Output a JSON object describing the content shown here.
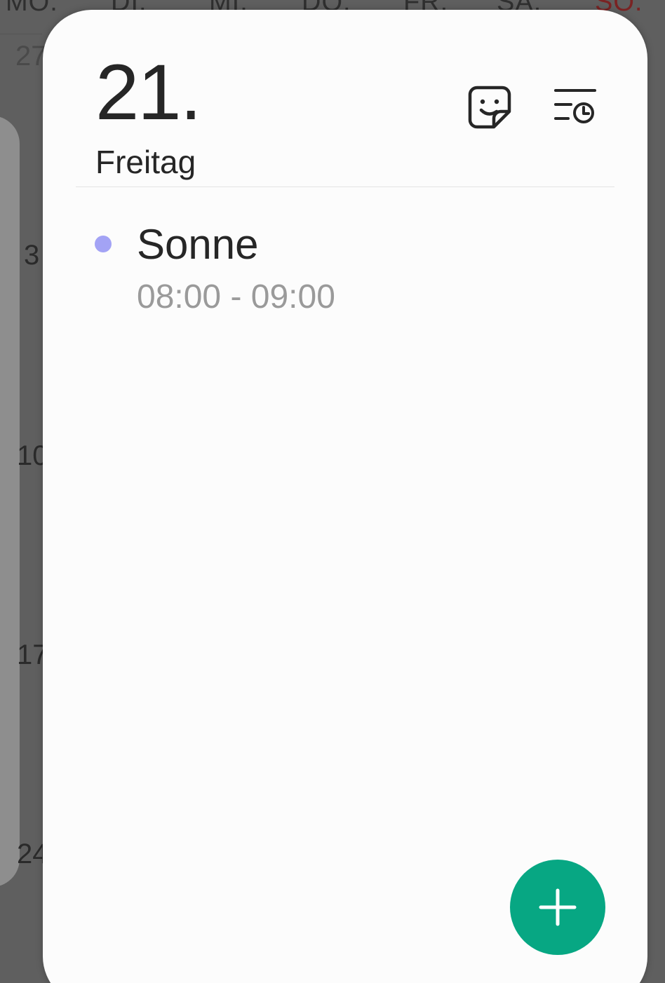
{
  "background": {
    "weekdays": [
      "MO.",
      "DI.",
      "MI.",
      "DO.",
      "FR.",
      "SA.",
      "SO."
    ],
    "week_dates": [
      "27",
      "3",
      "10",
      "17",
      "24"
    ]
  },
  "popup": {
    "day_number": "21.",
    "day_name": "Freitag",
    "icons": {
      "sticker": "sticker-icon",
      "schedule": "schedule-list-icon"
    },
    "events": [
      {
        "title": "Sonne",
        "time": "08:00 - 09:00",
        "color": "#a3a3f5"
      }
    ],
    "add_button_icon": "plus-icon"
  },
  "colors": {
    "accent": "#07a783",
    "sunday": "#7a2323"
  }
}
